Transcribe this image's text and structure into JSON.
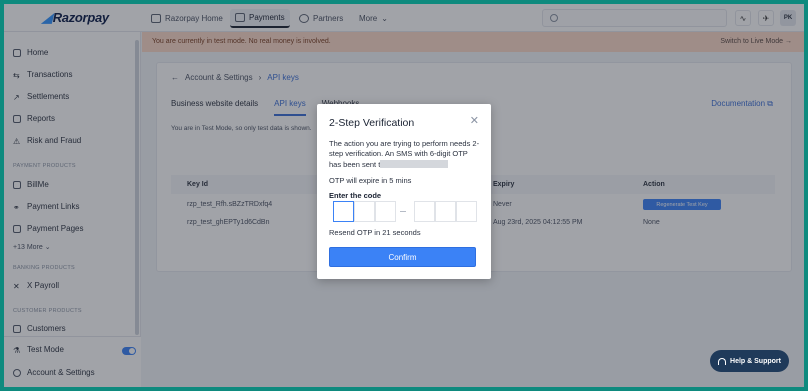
{
  "topnav": {
    "logo": "Razorpay",
    "tabs": [
      {
        "label": "Razorpay Home"
      },
      {
        "label": "Payments"
      },
      {
        "label": "Partners"
      },
      {
        "label": "More"
      }
    ],
    "user_initials": "PK"
  },
  "sidebar": {
    "items": [
      {
        "label": "Home"
      },
      {
        "label": "Transactions"
      },
      {
        "label": "Settlements"
      },
      {
        "label": "Reports"
      },
      {
        "label": "Risk and Fraud"
      }
    ],
    "sections": {
      "payment_products": "PAYMENT PRODUCTS",
      "banking_products": "BANKING PRODUCTS",
      "customer_products": "CUSTOMER PRODUCTS"
    },
    "payment_items": [
      {
        "label": "BillMe"
      },
      {
        "label": "Payment Links"
      },
      {
        "label": "Payment Pages"
      }
    ],
    "more_label": "+13 More",
    "banking_items": [
      {
        "label": "X Payroll"
      }
    ],
    "customer_items": [
      {
        "label": "Customers"
      }
    ],
    "bottom": {
      "test_mode": "Test Mode",
      "account_settings": "Account & Settings"
    }
  },
  "banner": {
    "text": "You are currently in test mode. No real money is involved.",
    "switch_label": "Switch to Live Mode"
  },
  "main": {
    "breadcrumb_parent": "Account & Settings",
    "breadcrumb_current": "API keys",
    "tabs": [
      {
        "label": "Business website details"
      },
      {
        "label": "API keys"
      },
      {
        "label": "Webhooks"
      }
    ],
    "doc_link": "Documentation",
    "test_note": "You are in Test Mode, so only test data is shown.",
    "columns": [
      "Key Id",
      "Expiry",
      "Action"
    ],
    "rows": [
      {
        "key": "rzp_test_Rfh.sBZzTRDxfq4",
        "expiry": "Never",
        "action": "Regenerate Test Key"
      },
      {
        "key": "rzp_test_ghEPTy1d6CdBn",
        "expiry": "Aug 23rd, 2025 04:12:55 PM",
        "action": "None"
      }
    ]
  },
  "modal": {
    "title": "2-Step Verification",
    "body": "The action you are trying to perform needs 2-step verification. An SMS with 6-digit OTP has been sent t",
    "expire_text": "OTP will expire in 5 mins",
    "enter_label": "Enter the code",
    "resend_text": "Resend OTP in 21 seconds",
    "confirm_label": "Confirm"
  },
  "help": {
    "label": "Help & Support"
  }
}
